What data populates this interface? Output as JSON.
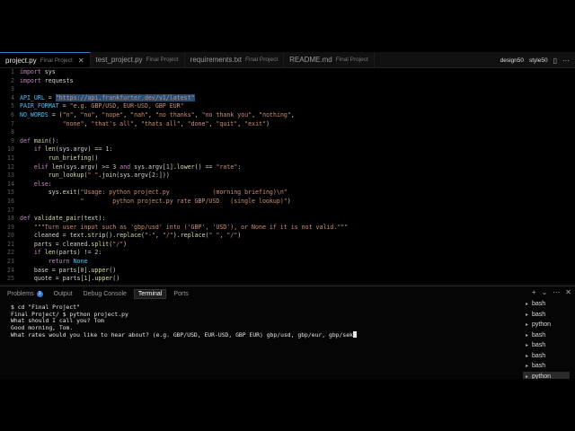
{
  "tabs": [
    {
      "name": "project.py",
      "folder": "Final Project",
      "active": true,
      "close": "✕"
    },
    {
      "name": "test_project.py",
      "folder": "Final Project",
      "active": false,
      "close": ""
    },
    {
      "name": "requirements.txt",
      "folder": "Final Project",
      "active": false,
      "close": ""
    },
    {
      "name": "README.md",
      "folder": "Final Project",
      "active": false,
      "close": ""
    }
  ],
  "tab_right": {
    "user1": "design50",
    "user2": "style50"
  },
  "code_lines": [
    {
      "n": "1",
      "html": "<span class='kw'>import</span> sys"
    },
    {
      "n": "2",
      "html": "<span class='kw'>import</span> requests"
    },
    {
      "n": "3",
      "html": ""
    },
    {
      "n": "4",
      "html": "<span class='cst'>API_URL</span> = <span class='str hl'>\"https://api.frankfurter.dev/v1/latest\"</span>"
    },
    {
      "n": "5",
      "html": "<span class='cst'>PAIR_FORMAT</span> = <span class='str'>\"e.g. GBP/USD, EUR-USD, GBP EUR\"</span>"
    },
    {
      "n": "6",
      "html": "<span class='cst'>NO_WORDS</span> = (<span class='str'>\"n\"</span>, <span class='str'>\"no\"</span>, <span class='str'>\"nope\"</span>, <span class='str'>\"nah\"</span>, <span class='str'>\"no thanks\"</span>, <span class='str'>\"no thank you\"</span>, <span class='str'>\"nothing\"</span>,"
    },
    {
      "n": "7",
      "html": "            <span class='str'>\"none\"</span>, <span class='str'>\"that's all\"</span>, <span class='str'>\"thats all\"</span>, <span class='str'>\"done\"</span>, <span class='str'>\"quit\"</span>, <span class='str'>\"exit\"</span>)"
    },
    {
      "n": "8",
      "html": ""
    },
    {
      "n": "9",
      "html": "<span class='kw'>def</span> <span class='fn'>main</span>():"
    },
    {
      "n": "10",
      "html": "    <span class='kw'>if</span> <span class='fn'>len</span>(sys.argv) == <span class='num'>1</span>:"
    },
    {
      "n": "11",
      "html": "        <span class='fn'>run_briefing</span>()"
    },
    {
      "n": "12",
      "html": "    <span class='kw'>elif</span> <span class='fn'>len</span>(sys.argv) >= <span class='num'>3</span> <span class='kw'>and</span> sys.argv[<span class='num'>1</span>].<span class='fn'>lower</span>() == <span class='str'>\"rate\"</span>:"
    },
    {
      "n": "13",
      "html": "        <span class='fn'>run_lookup</span>(<span class='str'>\" \"</span>.<span class='fn'>join</span>(sys.argv[<span class='num'>2</span>:]))"
    },
    {
      "n": "14",
      "html": "    <span class='kw'>else</span>:"
    },
    {
      "n": "15",
      "html": "        sys.<span class='fn'>exit</span>(<span class='str'>\"Usage: python project.py            (morning briefing)\\n\"</span>"
    },
    {
      "n": "16",
      "html": "                 <span class='str'>\"        python project.py rate GBP/USD   (single lookup)\"</span>)"
    },
    {
      "n": "17",
      "html": ""
    },
    {
      "n": "18",
      "html": "<span class='kw'>def</span> <span class='fn'>validate_pair</span>(text):"
    },
    {
      "n": "19",
      "html": "    <span class='str'>\"\"\"Turn user input such as 'gbp/usd' into ('GBP', 'USD'), or None if it is not valid.\"\"\"</span>"
    },
    {
      "n": "20",
      "html": "    cleaned = text.<span class='fn'>strip</span>().<span class='fn'>replace</span>(<span class='str'>\"-\"</span>, <span class='str'>\"/\"</span>).<span class='fn'>replace</span>(<span class='str'>\" \"</span>, <span class='str'>\"/\"</span>)"
    },
    {
      "n": "21",
      "html": "    parts = cleaned.<span class='fn'>split</span>(<span class='str'>\"/\"</span>)"
    },
    {
      "n": "22",
      "html": "    <span class='kw'>if</span> <span class='fn'>len</span>(parts) != <span class='num'>2</span>:"
    },
    {
      "n": "23",
      "html": "        <span class='kw'>return</span> <span class='cst'>None</span>"
    },
    {
      "n": "24",
      "html": "    base = parts[<span class='num'>0</span>].<span class='fn'>upper</span>()"
    },
    {
      "n": "25",
      "html": "    quote = parts[<span class='num'>1</span>].<span class='fn'>upper</span>()"
    },
    {
      "n": "26",
      "html": "    <span class='kw'>for</span> code <span class='kw'>in</span> (base, quote):"
    }
  ],
  "panel_tabs": [
    {
      "label": "Problems",
      "badge": "1",
      "active": false
    },
    {
      "label": "Output",
      "badge": "",
      "active": false
    },
    {
      "label": "Debug Console",
      "badge": "",
      "active": false
    },
    {
      "label": "Terminal",
      "badge": "",
      "active": true
    },
    {
      "label": "Ports",
      "badge": "",
      "active": false
    }
  ],
  "panel_tools": [
    "+",
    "⌄",
    "⋯",
    "✕"
  ],
  "terminal_lines": [
    "$ cd \"Final Project\"",
    "Final Project/ $ python project.py",
    "What should I call you? Tom",
    "Good morning, Tom.",
    "What rates would you like to hear about? (e.g. GBP/USD, EUR-USD, GBP EUR) gbp/usd, gbp/eur, gbp/sek"
  ],
  "shells": [
    {
      "name": "bash",
      "active": false
    },
    {
      "name": "bash",
      "active": false
    },
    {
      "name": "python",
      "active": false
    },
    {
      "name": "bash",
      "active": false
    },
    {
      "name": "bash",
      "active": false
    },
    {
      "name": "bash",
      "active": false
    },
    {
      "name": "bash",
      "active": false
    },
    {
      "name": "python",
      "active": true
    }
  ]
}
